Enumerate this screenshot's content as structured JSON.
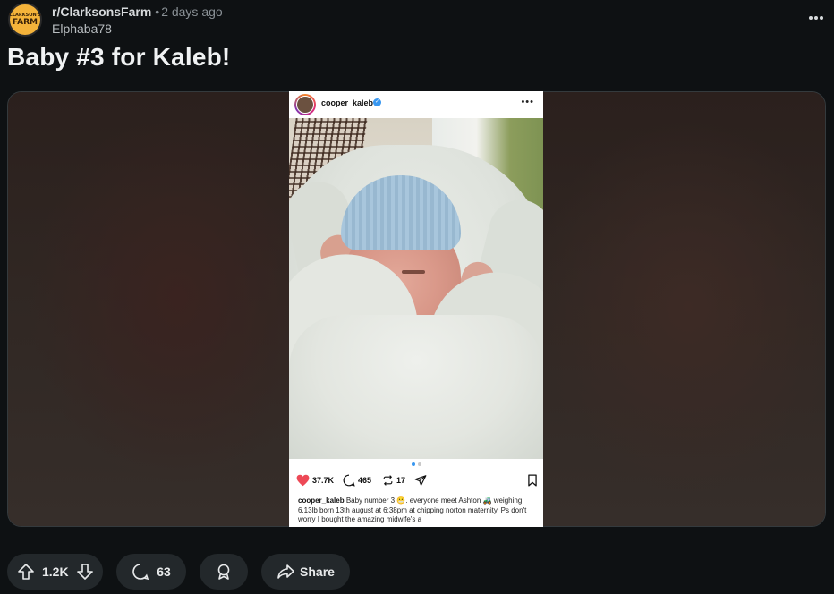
{
  "post": {
    "subreddit": "r/ClarksonsFarm",
    "separator": "•",
    "time": "2 days ago",
    "author": "Elphaba78",
    "title": "Baby #3 for Kaleb!",
    "avatar_text_top": "CLARKSON'S",
    "avatar_text_bottom": "FARM"
  },
  "instagram": {
    "username": "cooper_kaleb",
    "likes": "37.7K",
    "comments": "465",
    "reposts": "17",
    "caption_user": "cooper_kaleb",
    "caption_text": "Baby number 3 😬. everyone meet Ashton 🚜 weighing 6.13lb born 13th august at 6:38pm at chipping norton maternity. Ps don't worry I bought the amazing midwife's a",
    "carousel_count": 2,
    "carousel_active": 1
  },
  "actions": {
    "score": "1.2K",
    "comments": "63",
    "share_label": "Share"
  },
  "colors": {
    "background": "#0e1113",
    "pill": "#23282b",
    "subreddit_icon": "#f4b33a",
    "ig_like": "#ed4956",
    "ig_verified": "#3897f0"
  },
  "icons": [
    "more-horizontal-icon",
    "upvote-icon",
    "downvote-icon",
    "comment-icon",
    "award-icon",
    "share-icon",
    "heart-icon",
    "repost-icon",
    "send-icon",
    "bookmark-icon",
    "verified-icon"
  ]
}
